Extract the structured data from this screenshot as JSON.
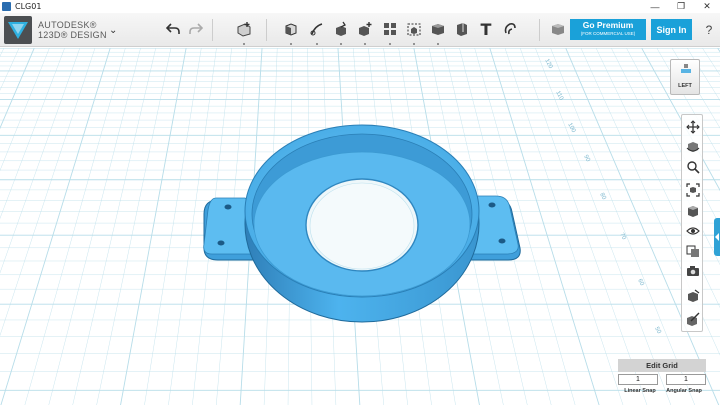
{
  "window": {
    "title": "CLG01",
    "minimize_glyph": "—",
    "restore_glyph": "❐",
    "close_glyph": "✕"
  },
  "brand": {
    "line1": "AUTODESK®",
    "line2": "123D® DESIGN",
    "menu_glyph": "⌄",
    "logo_icon": "autodesk-logo-icon"
  },
  "toolbar": {
    "undo_icon": "undo-icon",
    "redo_icon": "redo-icon",
    "text_tool_label": "T",
    "tools": [
      "transform-icon",
      "primitives-icon",
      "sketch-icon",
      "construct-icon",
      "modify-icon",
      "pattern-icon",
      "grouping-icon",
      "combine-icon",
      "measure-icon",
      "text-icon",
      "snap-icon",
      "material-icon"
    ]
  },
  "account": {
    "premium_label": "Go Premium",
    "premium_sub": "(FOR COMMERCIAL USE)",
    "signin_label": "Sign In",
    "help_label": "?"
  },
  "viewcube": {
    "face_label": "LEFT"
  },
  "navbar": {
    "items": [
      "pan-icon",
      "orbit-icon",
      "zoom-icon",
      "fit-icon",
      "view-mode-icon",
      "visibility-icon",
      "materials-icon",
      "snapshot-icon",
      "measure-icon",
      "materials-brush-icon"
    ]
  },
  "ruler": {
    "labels": [
      "120",
      "110",
      "100",
      "90",
      "80",
      "70",
      "60",
      "50"
    ]
  },
  "edit_grid": {
    "title": "Edit Grid",
    "linear_snap_value": "1",
    "angular_snap_value": "1",
    "linear_snap_label": "Linear Snap",
    "angular_snap_label": "Angular Snap"
  },
  "colors": {
    "accent": "#1aa1d9",
    "model_blue": "#4db3ee",
    "grid_line": "#b7dde9"
  }
}
